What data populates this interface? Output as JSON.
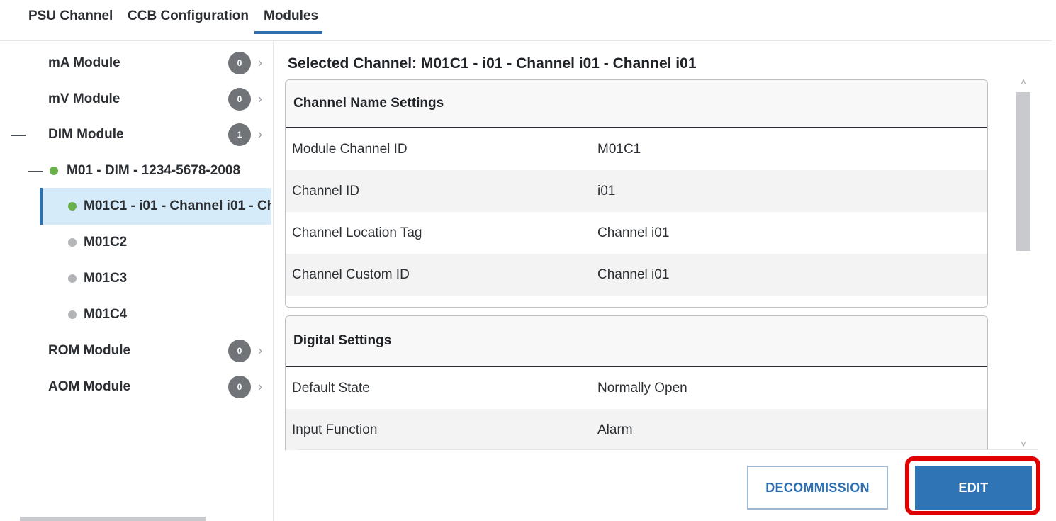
{
  "tabs": [
    {
      "label": "PSU Channel"
    },
    {
      "label": "CCB Configuration"
    },
    {
      "label": "Modules"
    }
  ],
  "active_tab": "Modules",
  "sidebar": {
    "modules": [
      {
        "label": "mA Module",
        "count": "0"
      },
      {
        "label": "mV Module",
        "count": "0"
      },
      {
        "label": "DIM Module",
        "count": "1"
      },
      {
        "label": "ROM Module",
        "count": "0"
      },
      {
        "label": "AOM Module",
        "count": "0"
      }
    ],
    "device": {
      "label": "M01 - DIM - 1234-5678-2008",
      "status": "green"
    },
    "channels": [
      {
        "label": "M01C1 - i01 - Channel i01 - Ch",
        "status": "green",
        "selected": true
      },
      {
        "label": "M01C2",
        "status": "grey"
      },
      {
        "label": "M01C3",
        "status": "grey"
      },
      {
        "label": "M01C4",
        "status": "grey"
      }
    ]
  },
  "main": {
    "title": "Selected Channel: M01C1 - i01 - Channel i01 - Channel i01",
    "channel_name_settings": {
      "title": "Channel Name Settings",
      "rows": [
        {
          "key": "Module Channel ID",
          "value": "M01C1"
        },
        {
          "key": "Channel ID",
          "value": "i01"
        },
        {
          "key": "Channel Location Tag",
          "value": "Channel i01"
        },
        {
          "key": "Channel Custom ID",
          "value": "Channel i01"
        }
      ]
    },
    "digital_settings": {
      "title": "Digital Settings",
      "rows": [
        {
          "key": "Default State",
          "value": "Normally Open"
        },
        {
          "key": "Input Function",
          "value": "Alarm"
        }
      ]
    }
  },
  "buttons": {
    "decommission": "DECOMMISSION",
    "edit": "EDIT"
  },
  "colors": {
    "accent": "#2f74b5",
    "selected_bg": "#d6ebf9",
    "status_green": "#6ab04c",
    "status_grey": "#b3b5b8",
    "highlight": "#e00000"
  }
}
